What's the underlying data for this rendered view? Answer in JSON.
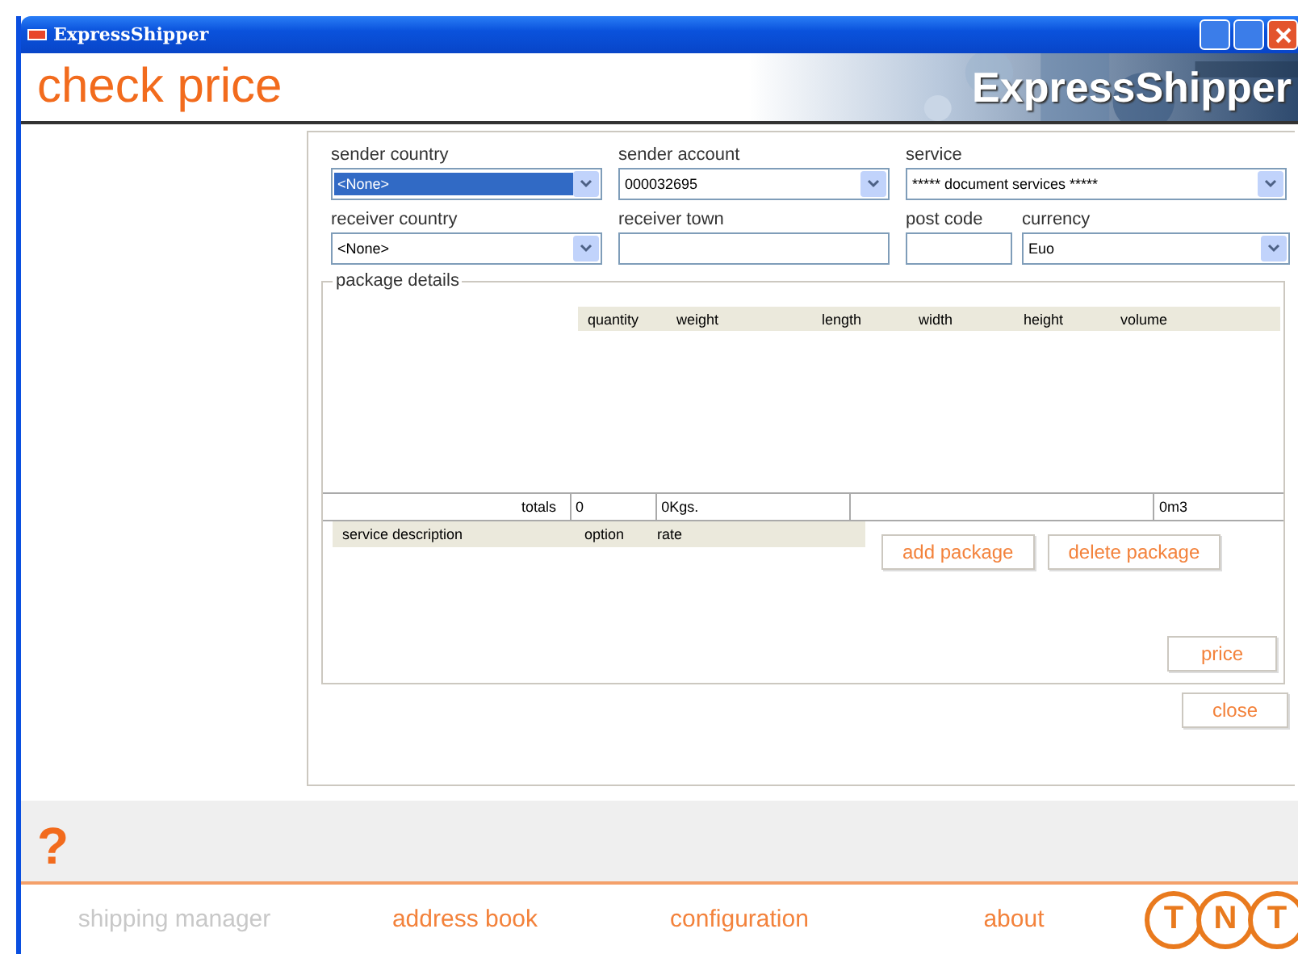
{
  "window": {
    "title": "ExpressShipper"
  },
  "header": {
    "title": "check price",
    "brand": "ExpressShipper"
  },
  "form_rows": [
    [
      {
        "label": "sender country",
        "value": "<None>",
        "kind": "dropdown",
        "focused": true
      },
      {
        "label": "sender account",
        "value": "000032695",
        "kind": "dropdown",
        "focused": false
      },
      {
        "label": "service",
        "value": "***** document services *****",
        "kind": "dropdown",
        "focused": false
      }
    ],
    [
      {
        "label": "receiver country",
        "value": "<None>",
        "kind": "dropdown",
        "focused": false
      },
      {
        "label": "receiver town",
        "kind": "text",
        "focused": false
      },
      {
        "label": "post code",
        "kind": "text",
        "focused": false
      },
      {
        "label": "currency",
        "value": "Euo",
        "kind": "dropdown",
        "focused": false
      }
    ]
  ],
  "package_details": {
    "legend": "package details",
    "columns": [
      "quantity",
      "weight",
      "length",
      "width",
      "height",
      "volume"
    ],
    "totals": {
      "label": "totals",
      "quantity": "0",
      "weight": "0Kgs.",
      "volume": "0m3"
    },
    "service_columns": [
      "service description",
      "option",
      "rate"
    ],
    "buttons": [
      "add package",
      "delete package"
    ],
    "price_button": "price"
  },
  "close_button": "close",
  "help": "?",
  "nav": [
    {
      "label": "shipping manager",
      "disabled": true
    },
    {
      "label": "address book",
      "disabled": false
    },
    {
      "label": "configuration",
      "disabled": false
    },
    {
      "label": "about",
      "disabled": false
    }
  ],
  "logo_letters": [
    "T",
    "N",
    "T"
  ]
}
